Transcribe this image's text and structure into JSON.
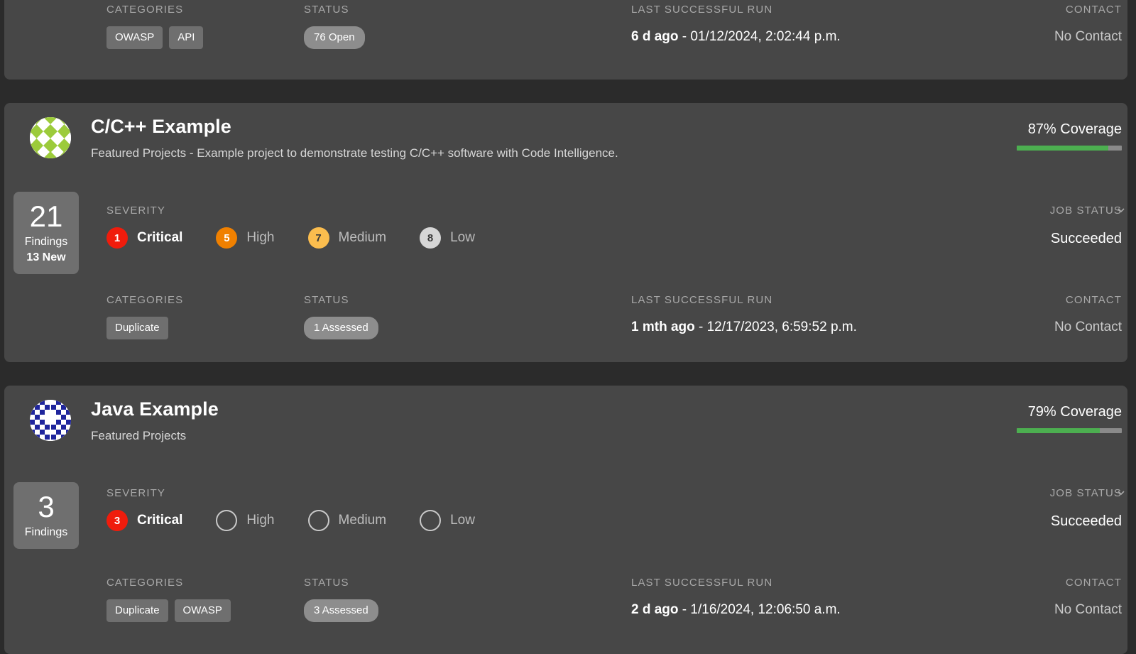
{
  "theme": {
    "page_bg": "#2b2b2b",
    "card_bg": "#474747",
    "chip_bg": "#6f6f6f",
    "pill_bg": "#8d8d8d",
    "label_color": "#a8a8a8",
    "coverage_fill": "#4caf50",
    "coverage_track": "#8a8a8a",
    "critical_color": "#f01c0c",
    "high_color": "#f08000",
    "medium_color": "#fbbd4e",
    "low_color": "#d6d6d6"
  },
  "labels": {
    "severity": "SEVERITY",
    "categories": "CATEGORIES",
    "status": "STATUS",
    "last_successful_run": "LAST SUCCESSFUL RUN",
    "contact": "CONTACT",
    "job_status": "JOB STATUS",
    "findings_word": "Findings",
    "critical": "Critical",
    "high": "High",
    "medium": "Medium",
    "low": "Low"
  },
  "cards": [
    {
      "id": "card-partial-top",
      "partial": true,
      "categories": [
        "OWASP",
        "API"
      ],
      "status_pill": "76 Open",
      "last_run_relative": "6 d ago",
      "last_run_absolute": " - 01/12/2024, 2:02:44 p.m.",
      "contact": "No Contact"
    },
    {
      "id": "card-c-cpp-example",
      "partial": false,
      "title": "C/C++ Example",
      "subtitle": "Featured Projects - Example project to demonstrate testing C/C++ software with Code Intelligence.",
      "avatar_icon": "identicon-green",
      "coverage_text": "87% Coverage",
      "coverage_percent": 87,
      "findings_count": "21",
      "findings_new": "13 New",
      "severity": [
        {
          "name": "Critical",
          "count": "1",
          "color": "#f01c0c",
          "text_color": "#ffffff",
          "empty": false,
          "active": true
        },
        {
          "name": "High",
          "count": "5",
          "color": "#f08000",
          "text_color": "#ffffff",
          "empty": false,
          "active": false
        },
        {
          "name": "Medium",
          "count": "7",
          "color": "#fbbd4e",
          "text_color": "#3a3a3a",
          "empty": false,
          "active": false
        },
        {
          "name": "Low",
          "count": "8",
          "color": "#d6d6d6",
          "text_color": "#3a3a3a",
          "empty": false,
          "active": false
        }
      ],
      "job_status": "Succeeded",
      "categories": [
        "Duplicate"
      ],
      "status_pill": "1 Assessed",
      "last_run_relative": "1 mth ago",
      "last_run_absolute": " - 12/17/2023, 6:59:52 p.m.",
      "contact": "No Contact"
    },
    {
      "id": "card-java-example",
      "partial": false,
      "title": "Java Example",
      "subtitle": "Featured Projects",
      "avatar_icon": "identicon-blue",
      "coverage_text": "79% Coverage",
      "coverage_percent": 79,
      "findings_count": "3",
      "findings_new": "",
      "severity": [
        {
          "name": "Critical",
          "count": "3",
          "color": "#f01c0c",
          "text_color": "#ffffff",
          "empty": false,
          "active": true
        },
        {
          "name": "High",
          "count": "",
          "color": "transparent",
          "text_color": "transparent",
          "empty": true,
          "active": false
        },
        {
          "name": "Medium",
          "count": "",
          "color": "transparent",
          "text_color": "transparent",
          "empty": true,
          "active": false
        },
        {
          "name": "Low",
          "count": "",
          "color": "transparent",
          "text_color": "transparent",
          "empty": true,
          "active": false
        }
      ],
      "job_status": "Succeeded",
      "categories": [
        "Duplicate",
        "OWASP"
      ],
      "status_pill": "3 Assessed",
      "last_run_relative": "2 d ago",
      "last_run_absolute": " - 1/16/2024, 12:06:50 a.m.",
      "contact": "No Contact"
    }
  ]
}
